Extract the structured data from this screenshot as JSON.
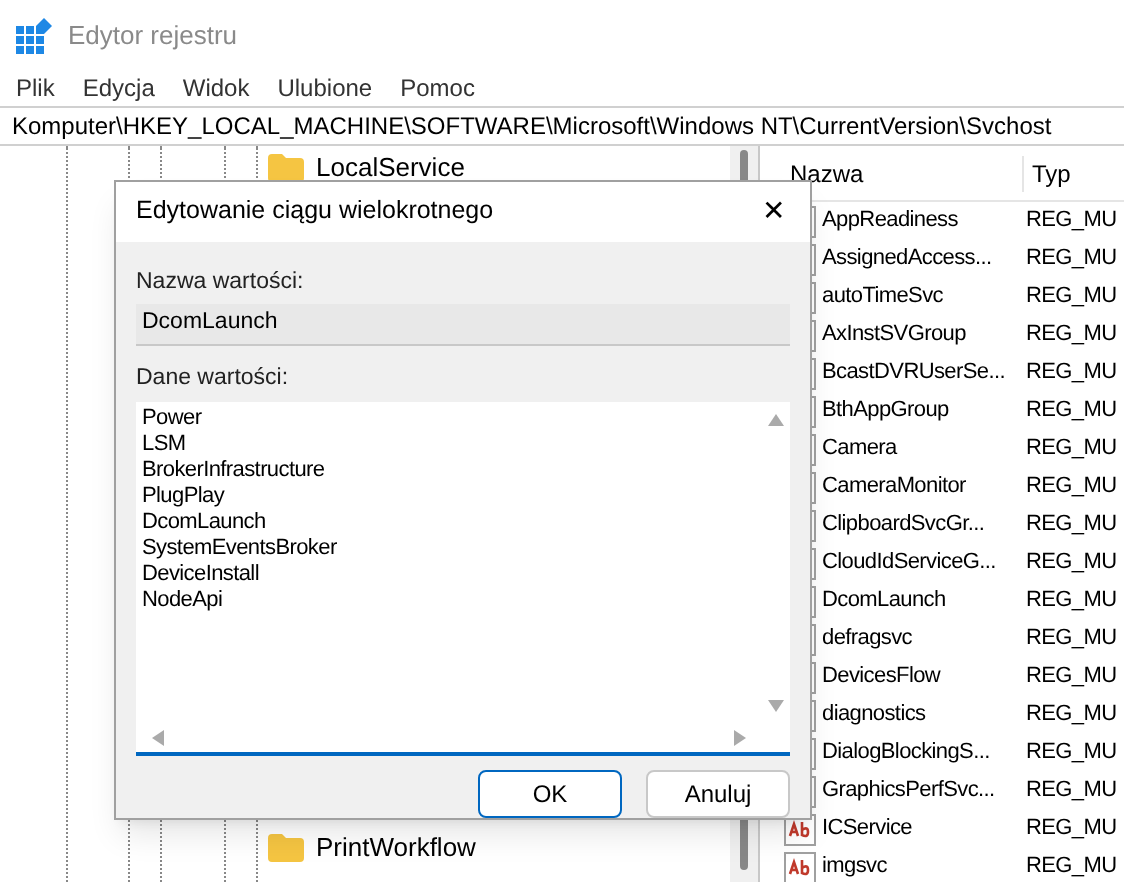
{
  "window": {
    "title": "Edytor rejestru"
  },
  "menu": [
    "Plik",
    "Edycja",
    "Widok",
    "Ulubione",
    "Pomoc"
  ],
  "address": "Komputer\\HKEY_LOCAL_MACHINE\\SOFTWARE\\Microsoft\\Windows NT\\CurrentVersion\\Svchost",
  "tree": {
    "items": [
      {
        "label": "LocalService"
      },
      {
        "label": "PrintWorkflow"
      }
    ]
  },
  "values": {
    "columns": [
      "Nazwa",
      "Typ"
    ],
    "rows": [
      {
        "name": "AppReadiness",
        "type": "REG_MU"
      },
      {
        "name": "AssignedAccess...",
        "type": "REG_MU"
      },
      {
        "name": "autoTimeSvc",
        "type": "REG_MU"
      },
      {
        "name": "AxInstSVGroup",
        "type": "REG_MU"
      },
      {
        "name": "BcastDVRUserSe...",
        "type": "REG_MU"
      },
      {
        "name": "BthAppGroup",
        "type": "REG_MU"
      },
      {
        "name": "Camera",
        "type": "REG_MU"
      },
      {
        "name": "CameraMonitor",
        "type": "REG_MU"
      },
      {
        "name": "ClipboardSvcGr...",
        "type": "REG_MU"
      },
      {
        "name": "CloudIdServiceG...",
        "type": "REG_MU"
      },
      {
        "name": "DcomLaunch",
        "type": "REG_MU"
      },
      {
        "name": "defragsvc",
        "type": "REG_MU"
      },
      {
        "name": "DevicesFlow",
        "type": "REG_MU"
      },
      {
        "name": "diagnostics",
        "type": "REG_MU"
      },
      {
        "name": "DialogBlockingS...",
        "type": "REG_MU"
      },
      {
        "name": "GraphicsPerfSvc...",
        "type": "REG_MU"
      },
      {
        "name": "ICService",
        "type": "REG_MU"
      },
      {
        "name": "imgsvc",
        "type": "REG_MU"
      }
    ]
  },
  "dialog": {
    "title": "Edytowanie ciągu wielokrotnego",
    "close": "✕",
    "name_label": "Nazwa wartości:",
    "name_value": "DcomLaunch",
    "data_label": "Dane wartości:",
    "data_lines": [
      "Power",
      "LSM",
      "BrokerInfrastructure",
      "PlugPlay",
      "DcomLaunch",
      "SystemEventsBroker",
      "DeviceInstall",
      "NodeApi"
    ],
    "buttons": [
      {
        "label": "OK",
        "default": true
      },
      {
        "label": "Anuluj",
        "default": false
      }
    ]
  }
}
